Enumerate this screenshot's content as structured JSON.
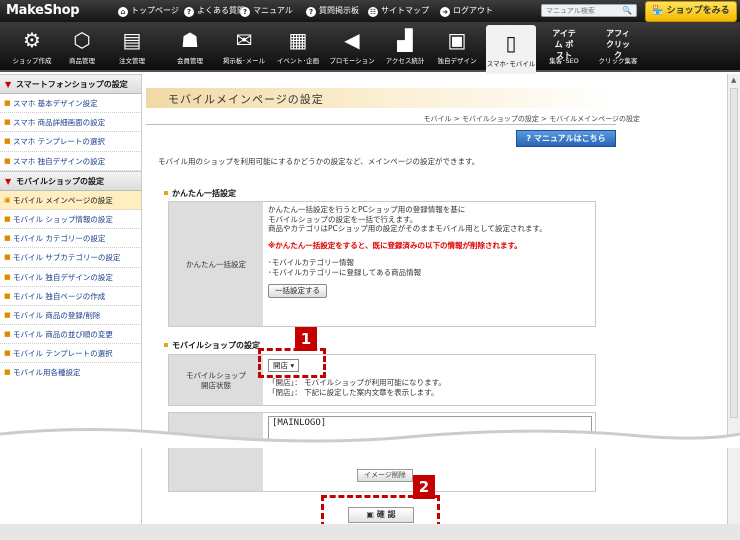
{
  "topbar": {
    "logo": "MakeShop",
    "links": [
      {
        "label": "トップページ"
      },
      {
        "label": "よくある質問"
      },
      {
        "label": "マニュアル"
      },
      {
        "label": "質問掲示板"
      },
      {
        "label": "サイトマップ"
      },
      {
        "label": "ログアウト"
      }
    ],
    "search_placeholder": "マニュアル検索",
    "shop_button": "ショップをみる"
  },
  "nav": [
    {
      "label": "ショップ作成",
      "icon": "gears-icon"
    },
    {
      "label": "商品管理",
      "icon": "box-icon"
    },
    {
      "label": "注文管理",
      "icon": "document-icon"
    },
    {
      "label": "会員管理",
      "icon": "people-icon"
    },
    {
      "label": "掲示板･メール",
      "icon": "envelope-icon"
    },
    {
      "label": "イベント･企画",
      "icon": "calendar-icon"
    },
    {
      "label": "プロモーション",
      "icon": "megaphone-icon"
    },
    {
      "label": "アクセス統計",
      "icon": "bar-chart-icon"
    },
    {
      "label": "独自デザイン",
      "icon": "picture-icon"
    },
    {
      "label": "スマホ･モバイル",
      "icon": "mobile-icon",
      "active": true
    },
    {
      "label": "集客･SEO",
      "icon": "item-post-icon",
      "badge": "アイテム ポスト"
    },
    {
      "label": "クリック集客",
      "icon": "affiliate-click-icon",
      "badge": "アフィ クリック"
    }
  ],
  "sidebar": {
    "smartphone_heading": "スマートフォンショップの設定",
    "smartphone_items": [
      {
        "label": "スマホ 基本デザイン設定"
      },
      {
        "label": "スマホ 商品詳細画面の設定"
      },
      {
        "label": "スマホ テンプレートの選択"
      },
      {
        "label": "スマホ 独自デザインの設定"
      }
    ],
    "mobile_heading": "モバイルショップの設定",
    "mobile_items": [
      {
        "label": "モバイル メインページの設定",
        "active": true
      },
      {
        "label": "モバイル ショップ情報の設定"
      },
      {
        "label": "モバイル カテゴリーの設定"
      },
      {
        "label": "モバイル サブカテゴリーの設定"
      },
      {
        "label": "モバイル 独自デザインの設定"
      },
      {
        "label": "モバイル 独自ページの作成"
      },
      {
        "label": "モバイル 商品の登録/削除"
      },
      {
        "label": "モバイル 商品の並び順の変更"
      },
      {
        "label": "モバイル テンプレートの選択"
      },
      {
        "label": "モバイル用各種設定"
      }
    ]
  },
  "main": {
    "title": "モバイルメインページの設定",
    "breadcrumb": "モバイル > モバイルショップの設定 > モバイルメインページの設定",
    "manual_button": "マニュアルはこちら",
    "description": "モバイル用のショップを利用可能にするかどうかの設定など、メインページの設定ができます。",
    "bulk": {
      "heading": "かんたん一括設定",
      "label": "かんたん一括設定",
      "lines": [
        "かんたん一括設定を行うとPCショップ用の登録情報を基に",
        "モバイルショップの設定を一括で行えます。",
        "商品やカテゴリはPCショップ用の設定がそのままモバイル用として設定されます。"
      ],
      "warning": "※かんたん一括設定をすると、既に登録済みの以下の情報が削除されます。",
      "items": [
        "･モバイルカテゴリー情報",
        "･モバイルカテゴリーに登録してある商品情報"
      ],
      "button": "一括設定する"
    },
    "mobile_shop": {
      "heading": "モバイルショップの設定",
      "status_label_1": "モバイルショップ",
      "status_label_2": "開店状態",
      "status_value": "開店",
      "note_1": "「開店」： モバイルショップが利用可能になります。",
      "note_2": "「閉店」： 下記に設定した案内文章を表示します。",
      "mainlogo": "[MAINLOGO]",
      "image_delete": "イメージ削除"
    },
    "confirm_button": "確 認",
    "callouts": [
      "1",
      "2"
    ]
  },
  "colors": {
    "callout_red": "#c40000",
    "manual_blue": "#2a64b4",
    "shop_yellow": "#f3b800",
    "warning_red": "#dd0000"
  }
}
